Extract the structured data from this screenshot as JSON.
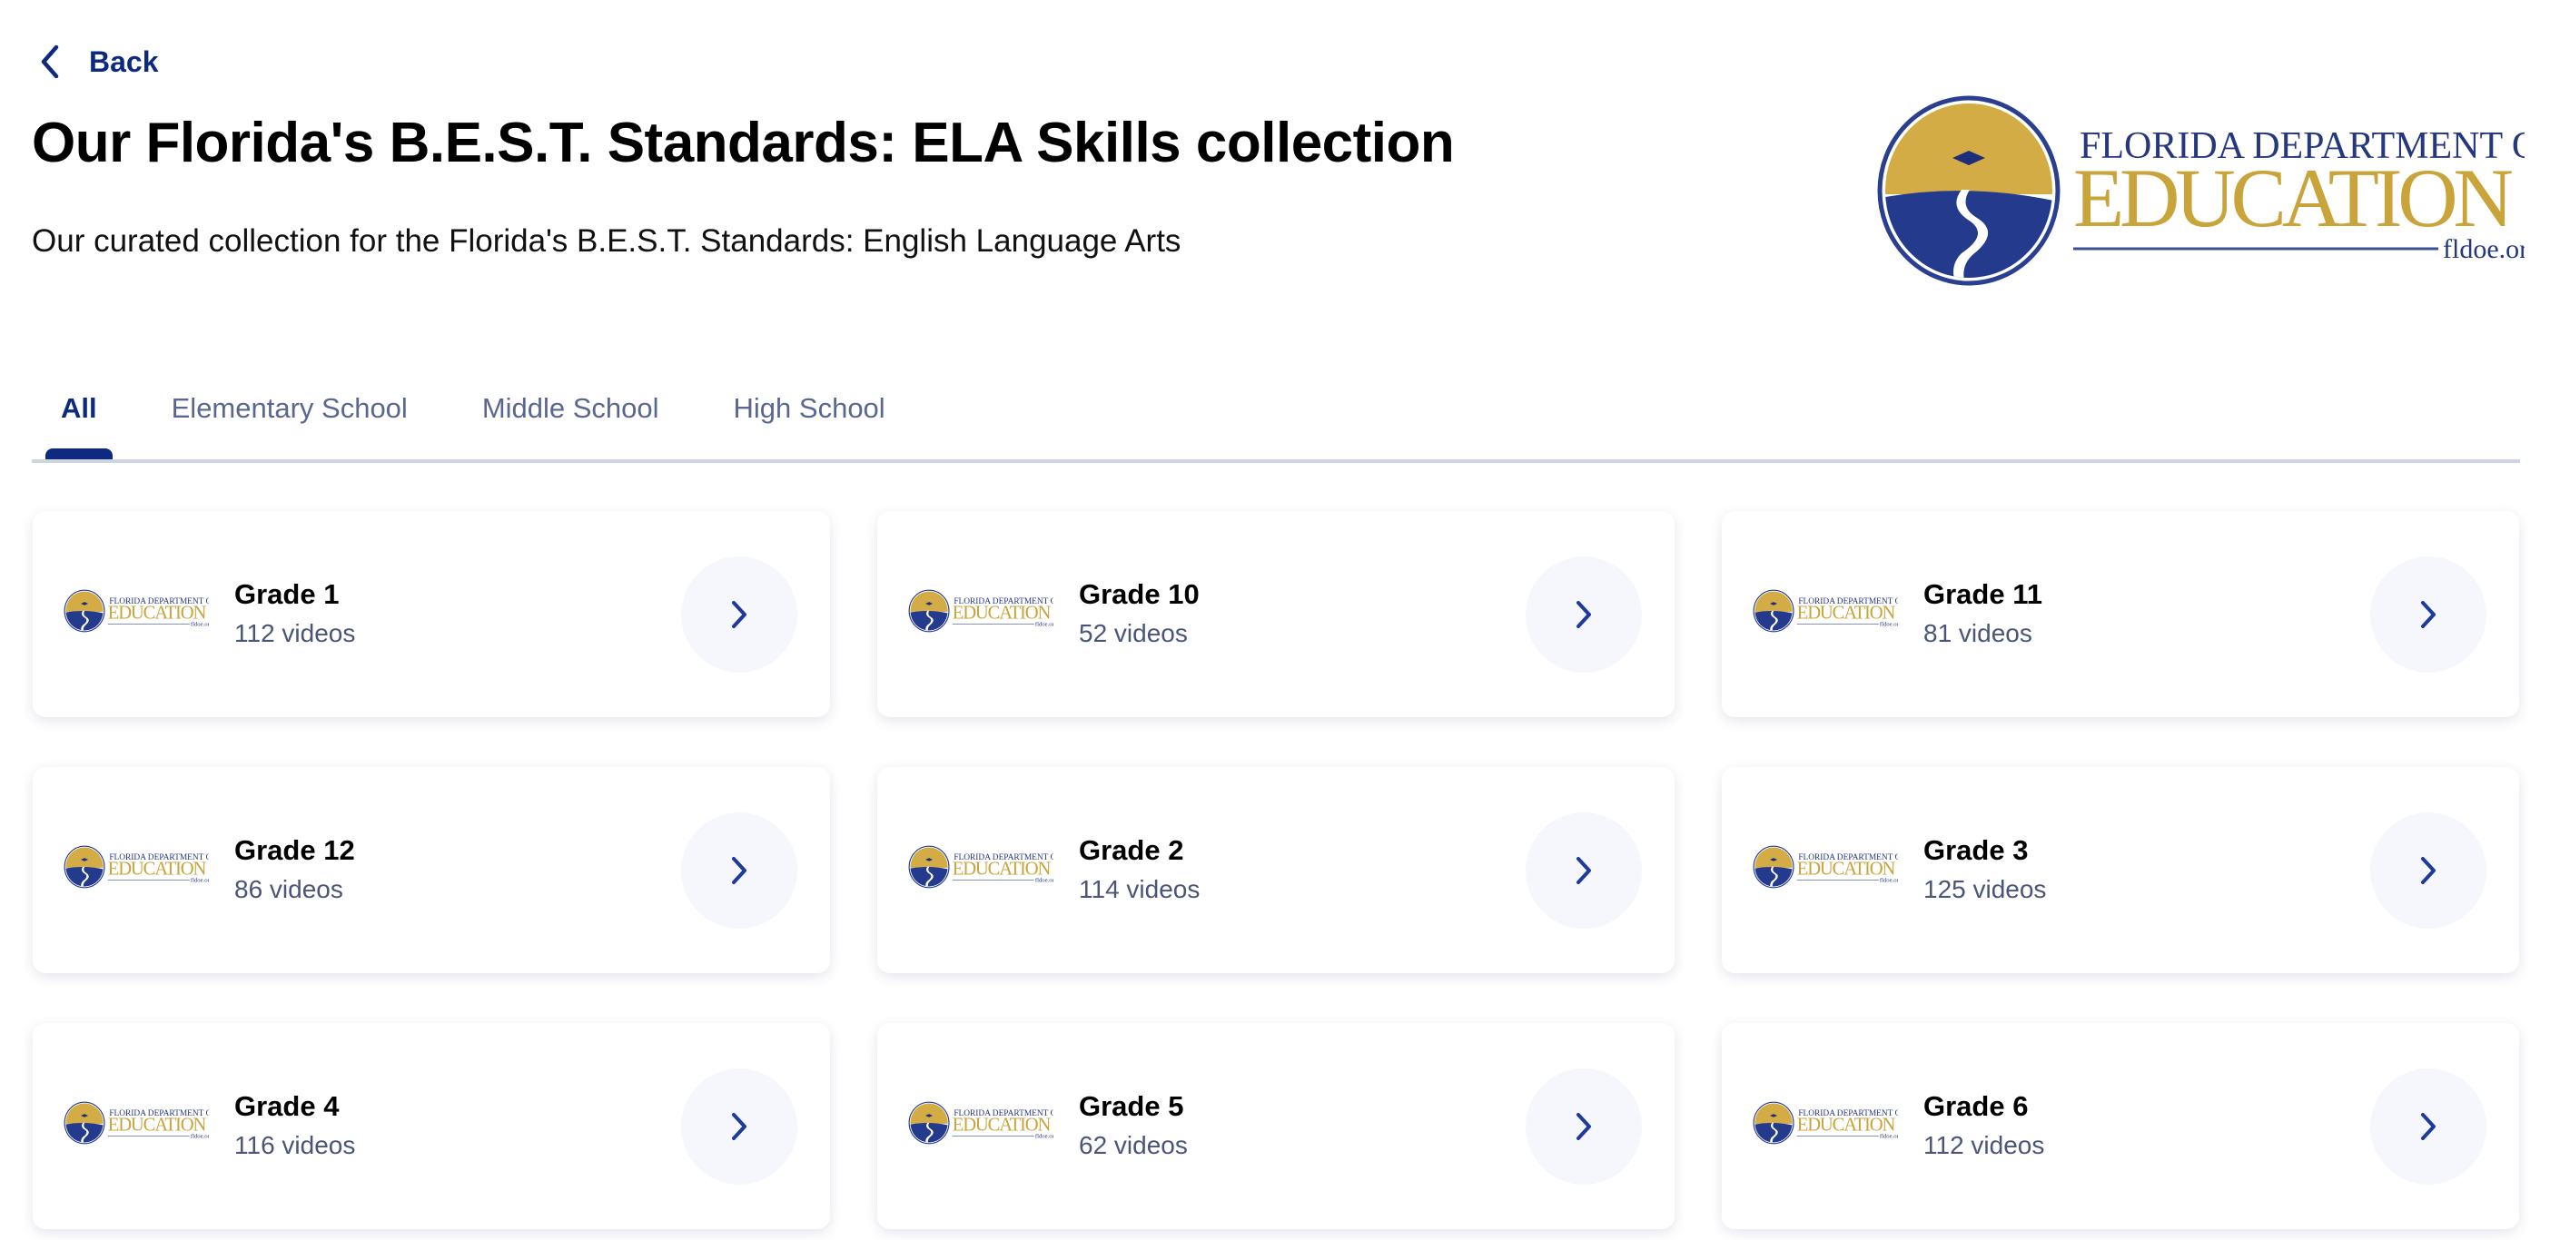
{
  "back_label": "Back",
  "title": "Our Florida's B.E.S.T. Standards: ELA Skills collection",
  "subtitle": "Our curated collection for the Florida's B.E.S.T. Standards: English Language Arts",
  "logo": {
    "line1": "FLORIDA DEPARTMENT OF",
    "line2": "EDUCATION",
    "line3": "fldoe.org"
  },
  "colors": {
    "accent": "#0e2a80",
    "gold": "#c9a43a",
    "muted": "#5a6790"
  },
  "tabs": [
    {
      "label": "All",
      "active": true
    },
    {
      "label": "Elementary School"
    },
    {
      "label": "Middle School"
    },
    {
      "label": "High School"
    }
  ],
  "cards": [
    {
      "title": "Grade 1",
      "count": "112 videos"
    },
    {
      "title": "Grade 10",
      "count": "52 videos"
    },
    {
      "title": "Grade 11",
      "count": "81 videos"
    },
    {
      "title": "Grade 12",
      "count": "86 videos"
    },
    {
      "title": "Grade 2",
      "count": "114 videos"
    },
    {
      "title": "Grade 3",
      "count": "125 videos"
    },
    {
      "title": "Grade 4",
      "count": "116 videos"
    },
    {
      "title": "Grade 5",
      "count": "62 videos"
    },
    {
      "title": "Grade 6",
      "count": "112 videos"
    }
  ]
}
